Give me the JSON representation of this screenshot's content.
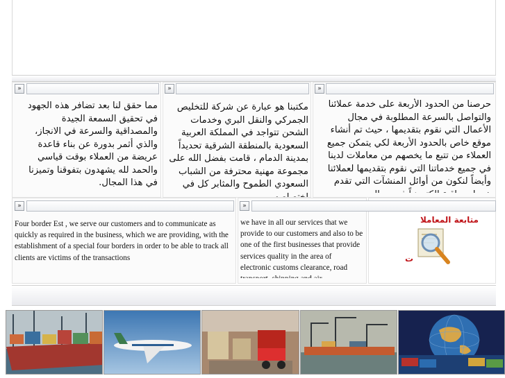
{
  "columns": [
    {
      "id": "right",
      "text": "حرصنا من الحدود الأربعة على خدمة عملائنا والتواصل بالسرعة المطلوبة في مجال الأعمال التي نقوم بتقديمها ، حيث تم أنشاء موقع خاص بالحدود الأربعة لكي يتمكن جميع العملاء من تتبع ما يخصهم من معاملات لدينا في جميع خدماتنا التي نقوم بتقديمها لعملائنا وأيضاً لنكون من أوائل المنشآت التي تقدم خدمات راقية الكترونياً في مجال"
    },
    {
      "id": "middle",
      "text": "مكتبنا هو عبارة عن شركة للتخليص الجمركي والنقل البري وخدمات الشحن تتواجد في المملكة العربية السعودية بالمنطقة الشرقية تحديداً بمدينة الدمام ، قامت بفضل الله على مجموعة مهنية محترفة من الشباب السعودي الطموح والمثابر كل في اختصاصه"
    },
    {
      "id": "left",
      "text": "مما حقق لنا بعد تضافر هذه الجهود في تحقيق السمعة الجيدة والمصداقية والسرعة في الانجاز، والذي أثمر بدورة عن بناء قاعدة عريضة من العملاء بوقت قياسي والحمد لله يشهدون بتفوقنا وتميزنا في هذا المجال."
    }
  ],
  "english_left": "Four border Est , we serve our customers and to communicate as quickly as required in the business, which we are providing, with the establishment of a special four borders in order to be able to track all clients are victims of the transactions",
  "english_middle": "we have in all our services that we provide to our customers and also to be one of the first businesses that provide services quality in the area of electronic customs clearance, road transport, shipping and air",
  "tracking": {
    "title": "متابعة المعاملا",
    "suffix": "ت",
    "title_color": "#c0151a",
    "icon": "magnifier-icon"
  },
  "arrow": "»",
  "photos": [
    {
      "icon": "cargo-ship-photo"
    },
    {
      "icon": "airplane-photo"
    },
    {
      "icon": "warehouse-forklift-photo"
    },
    {
      "icon": "port-cranes-photo"
    },
    {
      "icon": "globe-containers-photo"
    }
  ]
}
